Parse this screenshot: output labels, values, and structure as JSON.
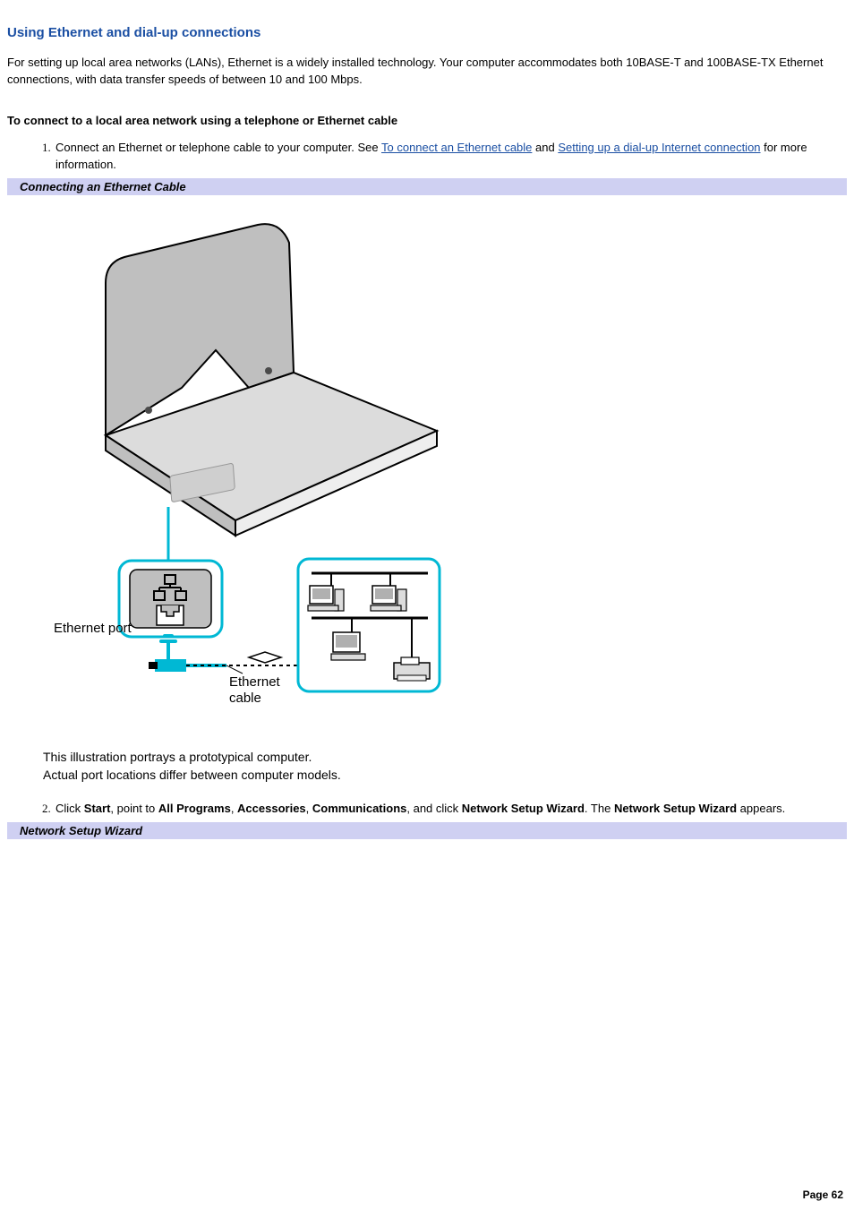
{
  "heading": "Using Ethernet and dial-up connections",
  "intro": "For setting up local area networks (LANs), Ethernet is a widely installed technology. Your computer accommodates both 10BASE-T and 100BASE-TX Ethernet connections, with data transfer speeds of between 10 and 100 Mbps.",
  "subheading": "To connect to a local area network using a telephone or Ethernet cable",
  "step1": {
    "pre": "Connect an Ethernet or telephone cable to your computer. See ",
    "link1": "To connect an Ethernet cable",
    "mid": " and ",
    "link2": "Setting up a dial-up Internet connection",
    "post": " for more information."
  },
  "section1": "Connecting an Ethernet Cable",
  "figure": {
    "port_label": "Ethernet port",
    "cable_label_l1": "Ethernet",
    "cable_label_l2": "cable"
  },
  "caption_l1": "This illustration portrays a prototypical computer.",
  "caption_l2": "Actual port locations differ between computer models.",
  "step2": {
    "t1": "Click ",
    "b1": "Start",
    "t2": ", point to ",
    "b2": "All Programs",
    "t3": ", ",
    "b3": "Accessories",
    "t4": ", ",
    "b4": "Communications",
    "t5": ", and click ",
    "b5": "Network Setup Wizard",
    "t6": ". The ",
    "b6": "Network Setup Wizard",
    "t7": " appears."
  },
  "section2": "Network Setup Wizard",
  "page_label": "Page 62"
}
